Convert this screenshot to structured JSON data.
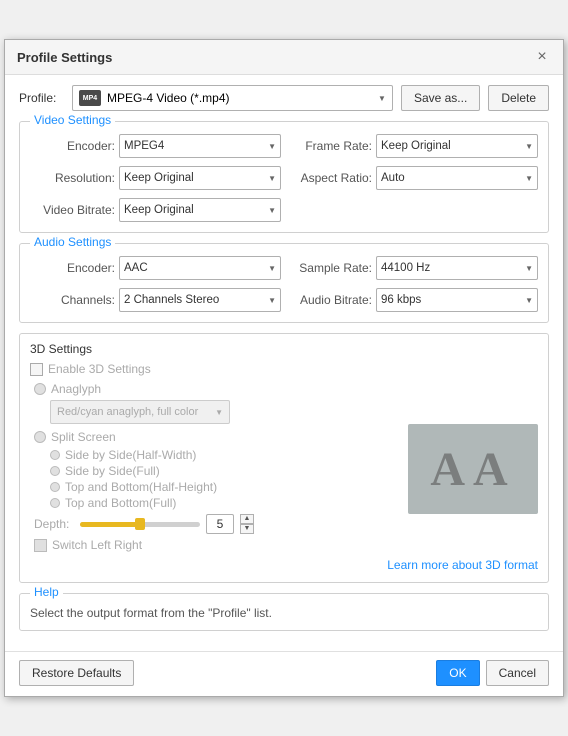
{
  "dialog": {
    "title": "Profile Settings",
    "close_label": "×"
  },
  "profile": {
    "label": "Profile:",
    "selected": "MPEG-4 Video (*.mp4)",
    "save_as_label": "Save as...",
    "delete_label": "Delete"
  },
  "video_settings": {
    "section_title": "Video Settings",
    "encoder_label": "Encoder:",
    "encoder_value": "MPEG4",
    "frame_rate_label": "Frame Rate:",
    "frame_rate_value": "Keep Original",
    "resolution_label": "Resolution:",
    "resolution_value": "Keep Original",
    "aspect_ratio_label": "Aspect Ratio:",
    "aspect_ratio_value": "Auto",
    "video_bitrate_label": "Video Bitrate:",
    "video_bitrate_value": "Keep Original"
  },
  "audio_settings": {
    "section_title": "Audio Settings",
    "encoder_label": "Encoder:",
    "encoder_value": "AAC",
    "sample_rate_label": "Sample Rate:",
    "sample_rate_value": "44100 Hz",
    "channels_label": "Channels:",
    "channels_value": "2 Channels Stereo",
    "audio_bitrate_label": "Audio Bitrate:",
    "audio_bitrate_value": "96 kbps"
  },
  "settings_3d": {
    "section_title": "3D Settings",
    "enable_label": "Enable 3D Settings",
    "anaglyph_label": "Anaglyph",
    "anaglyph_select_value": "Red/cyan anaglyph, full color",
    "split_screen_label": "Split Screen",
    "side_by_side_half_label": "Side by Side(Half-Width)",
    "side_by_side_full_label": "Side by Side(Full)",
    "top_bottom_half_label": "Top and Bottom(Half-Height)",
    "top_bottom_full_label": "Top and Bottom(Full)",
    "depth_label": "Depth:",
    "depth_value": "5",
    "switch_label": "Switch Left Right",
    "learn_more_label": "Learn more about 3D format",
    "aa_preview": "AA"
  },
  "help": {
    "section_title": "Help",
    "help_text": "Select the output format from the \"Profile\" list."
  },
  "footer": {
    "restore_label": "Restore Defaults",
    "ok_label": "OK",
    "cancel_label": "Cancel"
  }
}
